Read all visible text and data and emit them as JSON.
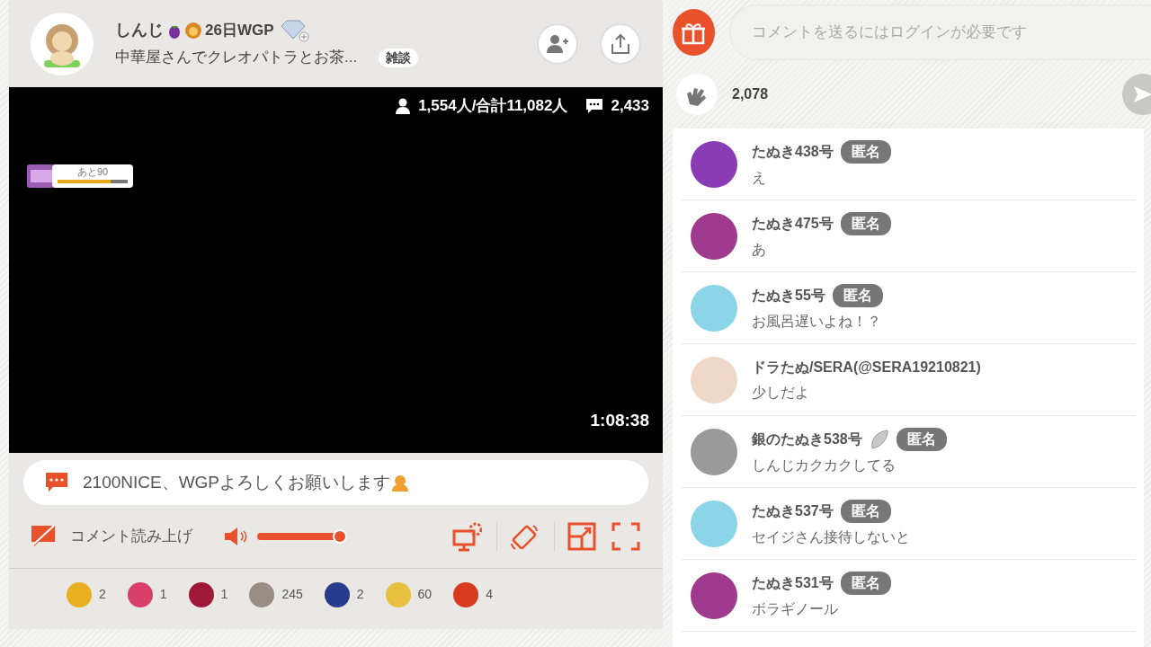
{
  "streamer": {
    "name": "しんじ",
    "badge_text": "26日WGP",
    "title": "中華屋さんでクレオパトラとお茶...",
    "category": "雑談"
  },
  "video": {
    "viewers": "1,554人/合計11,082人",
    "comments": "2,433",
    "elapsed": "1:08:38",
    "goal": {
      "label": "あと90",
      "level": 0.75
    }
  },
  "pinned_message": "2100NICE、WGPよろしくお願いします",
  "controls": {
    "read_aloud": {
      "label": "コメント読み上げ",
      "on": false
    },
    "volume": {
      "level": 1.0
    }
  },
  "gifts": [
    {
      "count": "2",
      "color": "#e8b020"
    },
    {
      "count": "1",
      "color": "#d8406a"
    },
    {
      "count": "1",
      "color": "#a01838"
    },
    {
      "count": "245",
      "color": "#9a8e84"
    },
    {
      "count": "2",
      "color": "#283c8c"
    },
    {
      "count": "60",
      "color": "#e8c040"
    },
    {
      "count": "4",
      "color": "#d83a20"
    }
  ],
  "comment_field": {
    "placeholder": "コメントを送るにはログインが必要です"
  },
  "claps": "2,078",
  "comments": [
    {
      "name": "たぬき438号",
      "tag": "匿名",
      "leaf_icon": false,
      "message": "え",
      "color": "#8a3cb4"
    },
    {
      "name": "たぬき475号",
      "tag": "匿名",
      "leaf_icon": false,
      "message": "あ",
      "color": "#a03a8c"
    },
    {
      "name": "たぬき55号",
      "tag": "匿名",
      "leaf_icon": false,
      "message": "お風呂遅いよね！？",
      "color": "#8cd4e8"
    },
    {
      "name": "ドラたぬ/SERA(@SERA19210821)",
      "leaf_icon": false,
      "message": "少しだよ",
      "color": "#f0d8c8"
    },
    {
      "name": "銀のたぬき538号",
      "tag": "匿名",
      "leaf_icon": true,
      "message": "しんじカクカクしてる",
      "color": "#9a9a9a"
    },
    {
      "name": "たぬき537号",
      "tag": "匿名",
      "leaf_icon": false,
      "message": "セイジさん接待しないと",
      "color": "#8cd4e8"
    },
    {
      "name": "たぬき531号",
      "tag": "匿名",
      "leaf_icon": false,
      "message": "ボラギノール",
      "color": "#a03a8c"
    }
  ]
}
